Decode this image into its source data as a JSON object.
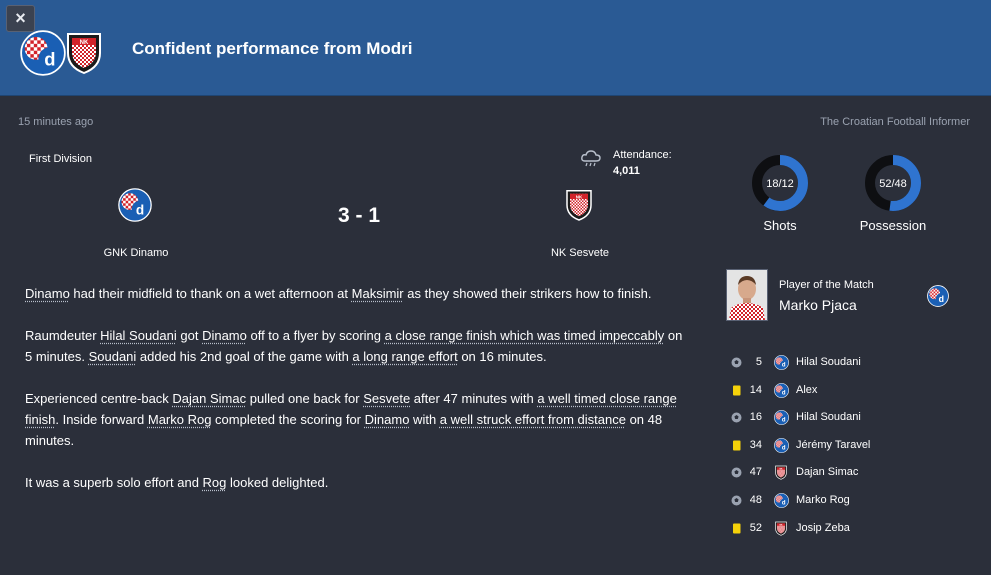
{
  "header": {
    "close_label": "×",
    "title": "Confident performance from Modri"
  },
  "meta": {
    "time_ago": "15 minutes ago",
    "source": "The Croatian Football Informer"
  },
  "match": {
    "competition": "First Division",
    "attendance_label": "Attendance:",
    "attendance_value": "4,011",
    "home_team": "GNK Dinamo",
    "away_team": "NK Sesvete",
    "score": "3 - 1"
  },
  "stats": {
    "shots_value": "18/12",
    "shots_label": "Shots",
    "possession_value": "52/48",
    "possession_label": "Possession"
  },
  "potm": {
    "label": "Player of the Match",
    "name": "Marko Pjaca"
  },
  "report": {
    "p1": [
      "Dinamo",
      " had their midfield to thank on a wet afternoon at ",
      "Maksimir",
      " as they showed their strikers how to finish."
    ],
    "p2": [
      "Raumdeuter ",
      "Hilal Soudani",
      " got ",
      "Dinamo",
      " off to a flyer by scoring ",
      "a close range finish which was timed impeccably",
      " on 5 minutes. ",
      "Soudani",
      " added his 2nd goal of the game with ",
      "a long range effort",
      " on 16 minutes."
    ],
    "p3": [
      "Experienced centre-back ",
      "Dajan Simac",
      " pulled one back for ",
      "Sesvete",
      " after 47 minutes with ",
      "a well timed close range finish",
      ". Inside forward ",
      "Marko Rog",
      " completed the scoring for ",
      "Dinamo",
      " with ",
      "a well struck effort from distance",
      " on 48 minutes."
    ],
    "p4": [
      "It was a superb solo effort and ",
      "Rog",
      " looked delighted."
    ]
  },
  "events": [
    {
      "type": "goal",
      "minute": "5",
      "team": "home",
      "player": "Hilal Soudani"
    },
    {
      "type": "yellow",
      "minute": "14",
      "team": "home",
      "player": "Alex"
    },
    {
      "type": "goal",
      "minute": "16",
      "team": "home",
      "player": "Hilal Soudani"
    },
    {
      "type": "yellow",
      "minute": "34",
      "team": "home",
      "player": "Jérémy Taravel"
    },
    {
      "type": "goal",
      "minute": "47",
      "team": "away",
      "player": "Dajan Simac"
    },
    {
      "type": "goal",
      "minute": "48",
      "team": "home",
      "player": "Marko Rog"
    },
    {
      "type": "yellow",
      "minute": "52",
      "team": "away",
      "player": "Josip Zeba"
    }
  ],
  "colors": {
    "header_bg": "#2a5a94",
    "page_bg": "#2b2f3a",
    "donut_blue": "#2f74d0",
    "yellow_card": "#f5d20a"
  },
  "icons": [
    "close-icon",
    "rain-cloud-icon",
    "goal-ball-icon",
    "yellow-card-icon",
    "dinamo-crest-icon",
    "sesvete-crest-icon"
  ]
}
